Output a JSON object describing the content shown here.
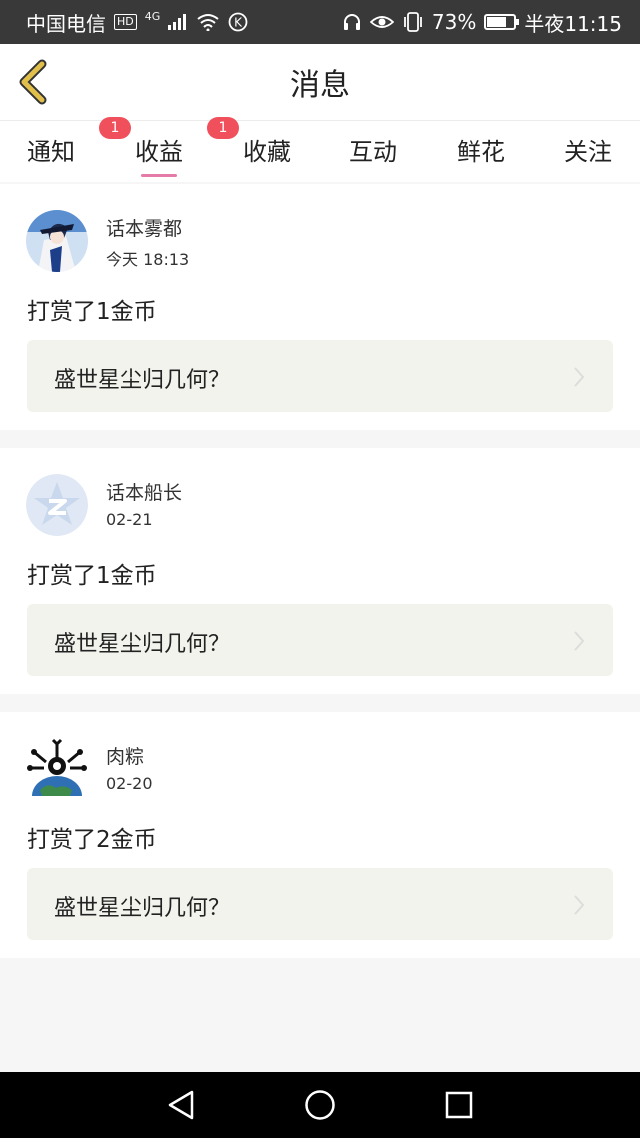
{
  "status_bar": {
    "carrier": "中国电信",
    "network": "4G",
    "hd_label": "HD",
    "battery_percent": "73%",
    "battery_level": 0.73,
    "time": "半夜11:15"
  },
  "header": {
    "title": "消息",
    "back_icon": "chevron-left-icon",
    "back_color": "#e0c04a"
  },
  "tabs": [
    {
      "label": "通知",
      "badge": "1",
      "active": false
    },
    {
      "label": "收益",
      "badge": "1",
      "active": true
    },
    {
      "label": "收藏",
      "badge": null,
      "active": false
    },
    {
      "label": "互动",
      "badge": null,
      "active": false
    },
    {
      "label": "鲜花",
      "badge": null,
      "active": false
    },
    {
      "label": "关注",
      "badge": null,
      "active": false
    }
  ],
  "messages": [
    {
      "username": "话本雾都",
      "time": "今天 18:13",
      "content": "打赏了1金币",
      "book": "盛世星尘归几何？",
      "avatar": "anime-avatar"
    },
    {
      "username": "话本船长",
      "time": "02-21",
      "content": "打赏了1金币",
      "book": "盛世星尘归几何？",
      "avatar": "default-qq-avatar"
    },
    {
      "username": "肉粽",
      "time": "02-20",
      "content": "打赏了2金币",
      "book": "盛世星尘归几何？",
      "avatar": "globe-avatar"
    }
  ],
  "colors": {
    "accent_pink": "#e57ba8",
    "badge_red": "#f0505c",
    "link_bg": "#f3f3ee"
  }
}
